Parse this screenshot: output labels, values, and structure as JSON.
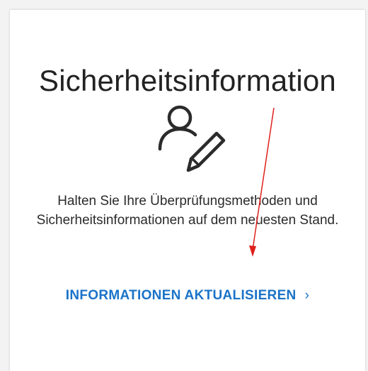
{
  "card": {
    "title": "Sicherheitsinformation",
    "icon": "user-edit-icon",
    "description": "Halten Sie Ihre Überprüfungsmethoden und Sicherheitsinformationen auf dem neuesten Stand.",
    "action_label": "INFORMATIONEN AKTUALISIEREN",
    "action_chevron": "›"
  },
  "colors": {
    "accent": "#1a73c8",
    "annotation_arrow": "#e0201b"
  }
}
